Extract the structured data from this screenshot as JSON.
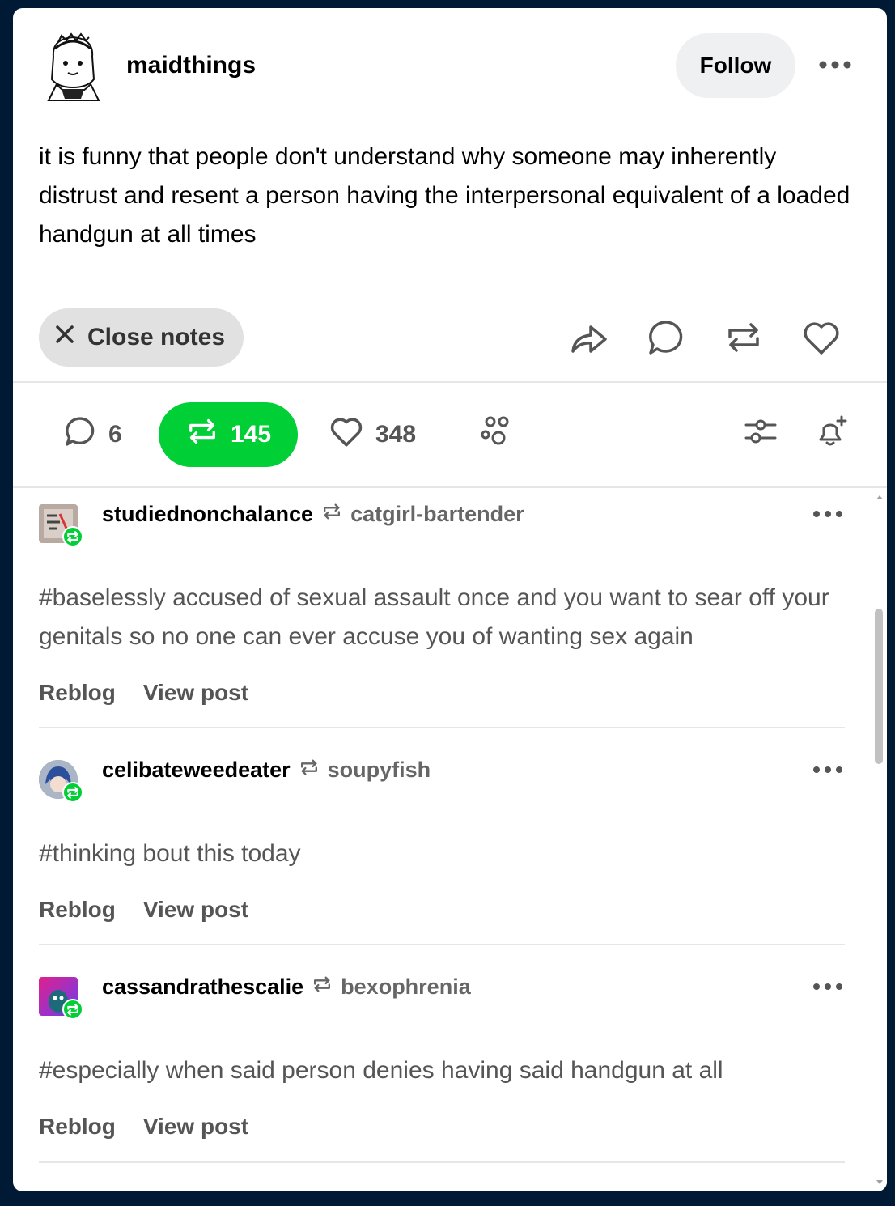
{
  "post": {
    "blog_name": "maidthings",
    "follow_label": "Follow",
    "body": "it is funny that people don't understand why someone may inherently distrust and resent a person having the interpersonal equivalent of a loaded handgun at all times",
    "close_notes_label": "Close notes"
  },
  "stats": {
    "replies": "6",
    "reblogs": "145",
    "likes": "348"
  },
  "notes": [
    {
      "user": "studiednonchalance",
      "source": "catgirl-bartender",
      "tags": "#baselessly accused of sexual assault once and you want to sear off your genitals so no one can ever accuse you of wanting sex again",
      "reblog_label": "Reblog",
      "view_label": "View post"
    },
    {
      "user": "celibateweedeater",
      "source": "soupyfish",
      "tags": "#thinking bout this today",
      "reblog_label": "Reblog",
      "view_label": "View post"
    },
    {
      "user": "cassandrathescalie",
      "source": "bexophrenia",
      "tags": "#especially when said person denies having said handgun at all",
      "reblog_label": "Reblog",
      "view_label": "View post"
    }
  ],
  "colors": {
    "background": "#001935",
    "reblog_green": "#00cf35",
    "text_secondary": "#555555"
  }
}
